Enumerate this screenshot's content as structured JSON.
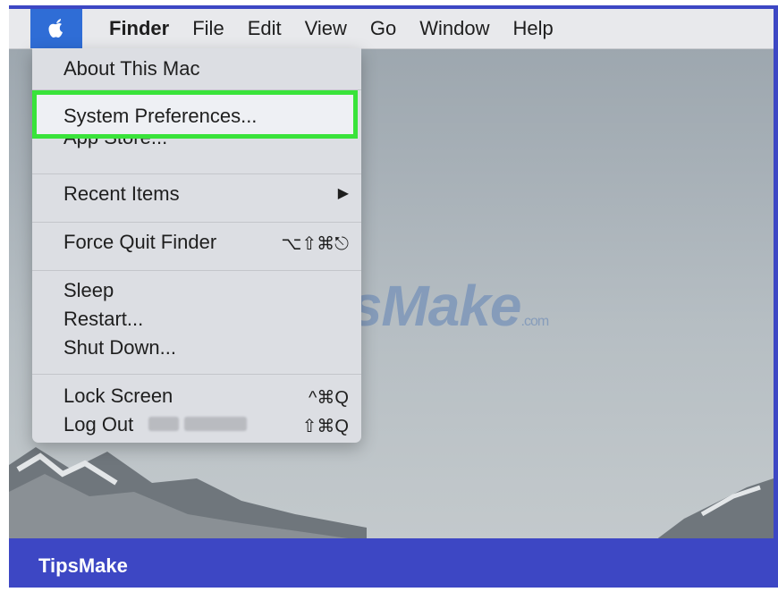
{
  "menubar": {
    "apple_icon": "apple-icon",
    "items": [
      "Finder",
      "File",
      "Edit",
      "View",
      "Go",
      "Window",
      "Help"
    ]
  },
  "apple_menu": {
    "about": "About This Mac",
    "system_preferences": "System Preferences...",
    "app_store_partial": "App Store...",
    "recent_items": "Recent Items",
    "recent_items_arrow": "▶",
    "force_quit": "Force Quit Finder",
    "force_quit_shortcut": "⌥⇧⌘⎋",
    "sleep": "Sleep",
    "restart": "Restart...",
    "shut_down": "Shut Down...",
    "lock_screen": "Lock Screen",
    "lock_screen_shortcut": "^⌘Q",
    "log_out": "Log Out",
    "log_out_shortcut": "⇧⌘Q"
  },
  "watermark": {
    "text": "TipsMake",
    "suffix": ".com"
  },
  "footer": {
    "brand": "TipsMake"
  },
  "colors": {
    "frame": "#3d47c4",
    "apple_highlight": "#2f6dd6",
    "highlight_border": "#39e33a"
  }
}
